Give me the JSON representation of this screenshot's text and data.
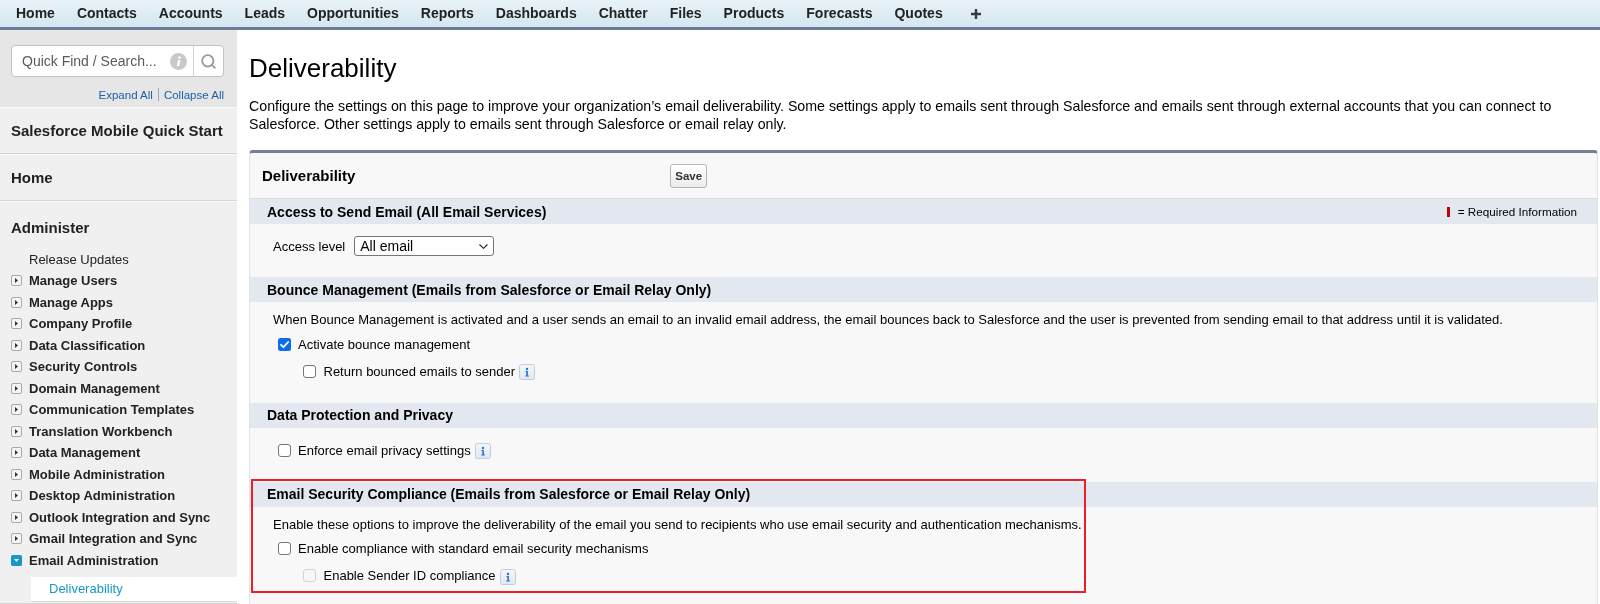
{
  "nav": {
    "tabs": [
      "Home",
      "Contacts",
      "Accounts",
      "Leads",
      "Opportunities",
      "Reports",
      "Dashboards",
      "Chatter",
      "Files",
      "Products",
      "Forecasts",
      "Quotes"
    ]
  },
  "sidebar": {
    "search": {
      "placeholder": "Quick Find / Search..."
    },
    "links": [
      "Expand All",
      "Collapse All"
    ],
    "sections": [
      {
        "title": "Salesforce Mobile Quick Start"
      },
      {
        "title": "Home"
      },
      {
        "title": "Administer",
        "items": [
          {
            "label": "Release Updates",
            "kind": "link",
            "selected": false
          },
          {
            "label": "Manage Users",
            "kind": "folder",
            "expanded": false,
            "selected": false
          },
          {
            "label": "Manage Apps",
            "kind": "folder",
            "expanded": false,
            "selected": false
          },
          {
            "label": "Company Profile",
            "kind": "folder",
            "expanded": false,
            "selected": false
          },
          {
            "label": "Data Classification",
            "kind": "folder",
            "expanded": false,
            "selected": false
          },
          {
            "label": "Security Controls",
            "kind": "folder",
            "expanded": false,
            "selected": false
          },
          {
            "label": "Domain Management",
            "kind": "folder",
            "expanded": false,
            "selected": false
          },
          {
            "label": "Communication Templates",
            "kind": "folder",
            "expanded": false,
            "selected": false
          },
          {
            "label": "Translation Workbench",
            "kind": "folder",
            "expanded": false,
            "selected": false
          },
          {
            "label": "Data Management",
            "kind": "folder",
            "expanded": false,
            "selected": false
          },
          {
            "label": "Mobile Administration",
            "kind": "folder",
            "expanded": false,
            "selected": false
          },
          {
            "label": "Desktop Administration",
            "kind": "folder",
            "expanded": false,
            "selected": false
          },
          {
            "label": "Outlook Integration and Sync",
            "kind": "folder",
            "expanded": false,
            "selected": false
          },
          {
            "label": "Gmail Integration and Sync",
            "kind": "folder",
            "expanded": false,
            "selected": false
          },
          {
            "label": "Email Administration",
            "kind": "folder",
            "expanded": true,
            "selected": false,
            "children": [
              {
                "label": "Deliverability",
                "kind": "link",
                "selected": true
              }
            ]
          }
        ]
      }
    ]
  },
  "main": {
    "title": "Deliverability",
    "description": "Configure the settings on this page to improve your organization’s email deliverability. Some settings apply to emails sent through Salesforce and emails sent through external accounts that you can connect to Salesforce. Other settings apply to emails sent through Salesforce or email relay only."
  },
  "panel": {
    "title": "Deliverability",
    "save_button": "Save",
    "sections": [
      {
        "title": "Access to Send Email (All Email Services)",
        "legend": "= Required Information",
        "highlighted": false,
        "rows": [
          {
            "kind": "select",
            "label": "Access level",
            "value": "All email"
          }
        ]
      },
      {
        "title": "Bounce Management (Emails from Salesforce or Email Relay Only)",
        "highlighted": false,
        "description": "When Bounce Management is activated and a user sends an email to an invalid email address, the email bounces back to Salesforce and the user is prevented from sending email to that address until it is validated.",
        "rows": [
          {
            "kind": "checkbox",
            "label": "Activate bounce management",
            "checked": true,
            "disabled": false,
            "info_icon": false,
            "children": [
              {
                "kind": "checkbox",
                "label": "Return bounced emails to sender",
                "checked": false,
                "disabled": false,
                "info_icon": true
              }
            ]
          }
        ]
      },
      {
        "title": "Data Protection and Privacy",
        "highlighted": false,
        "rows": [
          {
            "kind": "checkbox",
            "label": "Enforce email privacy settings",
            "checked": false,
            "disabled": false,
            "info_icon": true
          }
        ]
      },
      {
        "title": "Email Security Compliance (Emails from Salesforce or Email Relay Only)",
        "highlighted": true,
        "description": "Enable these options to improve the deliverability of the email you send to recipients who use email security and authentication mechanisms.",
        "rows": [
          {
            "kind": "checkbox",
            "label": "Enable compliance with standard email security mechanisms",
            "checked": false,
            "disabled": false,
            "info_icon": false,
            "children": [
              {
                "kind": "checkbox",
                "label": "Enable Sender ID compliance",
                "checked": false,
                "disabled": true,
                "info_icon": true
              }
            ]
          }
        ]
      }
    ]
  }
}
